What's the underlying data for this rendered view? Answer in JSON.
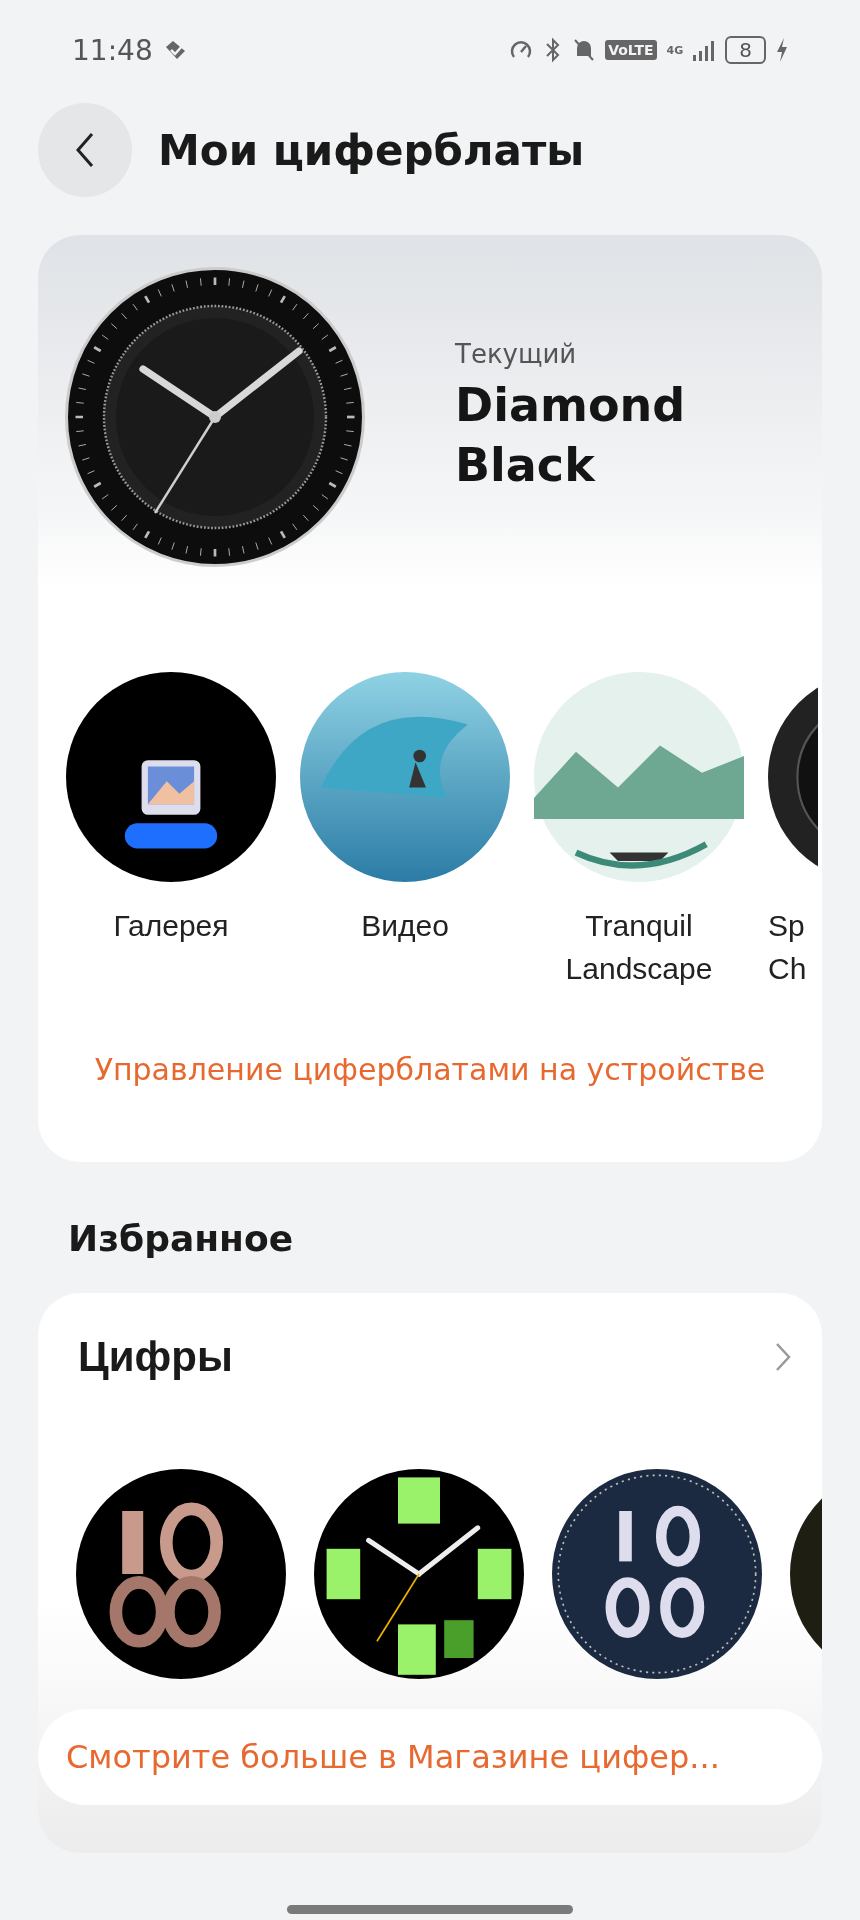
{
  "status_bar": {
    "time": "11:48",
    "volte": "VoLTE",
    "network": "4G",
    "battery": "8"
  },
  "header": {
    "title": "Мои циферблаты"
  },
  "current": {
    "label": "Текущий",
    "name": "Diamond Black"
  },
  "gallery": [
    {
      "label": "Галерея",
      "kind": "photo"
    },
    {
      "label": "Видео",
      "kind": "video"
    },
    {
      "label": "Tranquil Landscape",
      "kind": "landscape"
    },
    {
      "label": "Sp Ch",
      "kind": "sport"
    }
  ],
  "manage_link": "Управление циферблатами на устройстве",
  "favorites": {
    "title": "Избранное",
    "section": {
      "title": "Цифры",
      "faces": [
        {
          "kind": "rose"
        },
        {
          "kind": "green"
        },
        {
          "kind": "space"
        },
        {
          "kind": "dark"
        }
      ]
    },
    "store_link": "Смотрите больше в Магазине цифер..."
  }
}
